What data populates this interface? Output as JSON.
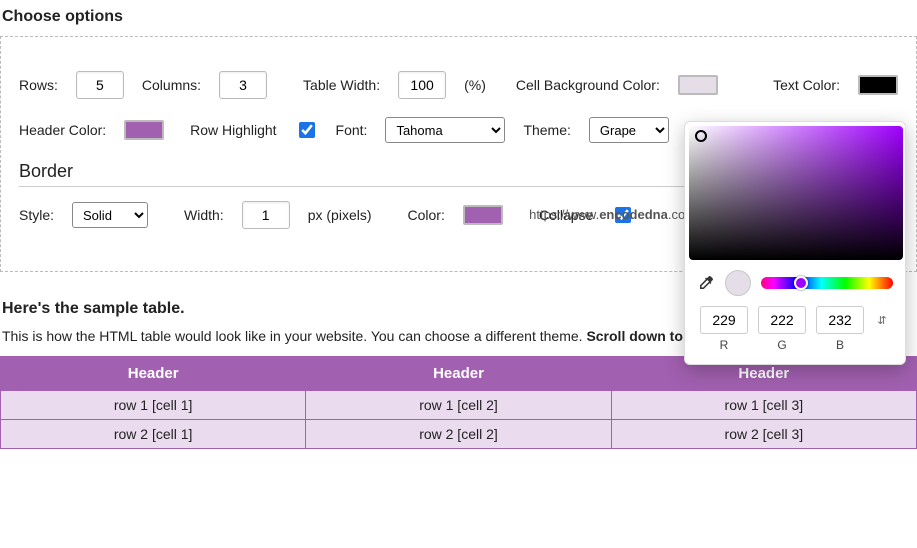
{
  "title": "Choose options",
  "options": {
    "rows_label": "Rows:",
    "rows_value": "5",
    "cols_label": "Columns:",
    "cols_value": "3",
    "tablewidth_label": "Table Width:",
    "tablewidth_value": "100",
    "tablewidth_unit": "(%)",
    "cellbg_label": "Cell Background Color:",
    "cellbg_color": "#e5dee8",
    "textcolor_label": "Text Color:",
    "text_color": "#000000",
    "headercolor_label": "Header Color:",
    "header_color": "#a260b0",
    "rowhighlight_label": "Row Highlight",
    "rowhighlight_checked": true,
    "font_label": "Font:",
    "font_value": "Tahoma",
    "theme_label": "Theme:",
    "theme_value": "Grape"
  },
  "border": {
    "heading": "Border",
    "style_label": "Style:",
    "style_value": "Solid",
    "width_label": "Width:",
    "width_value": "1",
    "width_unit": "px (pixels)",
    "color_label": "Color:",
    "color_value": "#a260b0",
    "collapse_label": "Collapse",
    "collapse_checked": true
  },
  "watermark": {
    "prefix": "https://www.",
    "bold": "encodedna",
    "suffix": ".com"
  },
  "picker": {
    "r": "229",
    "g": "222",
    "b": "232",
    "r_label": "R",
    "g_label": "G",
    "b_label": "B",
    "mode_toggle": "⇵",
    "current": "#e5dee8"
  },
  "sample": {
    "heading": "Here's the sample table.",
    "desc_a": "This is how the HTML table would look like in your website. You can choose a different theme. ",
    "desc_b": "Scroll down to see the code.",
    "headers": [
      "Header",
      "Header",
      "Header"
    ],
    "rows": [
      [
        "row 1 [cell 1]",
        "row 1 [cell 2]",
        "row 1 [cell 3]"
      ],
      [
        "row 2 [cell 1]",
        "row 2 [cell 2]",
        "row 2 [cell 3]"
      ]
    ]
  }
}
